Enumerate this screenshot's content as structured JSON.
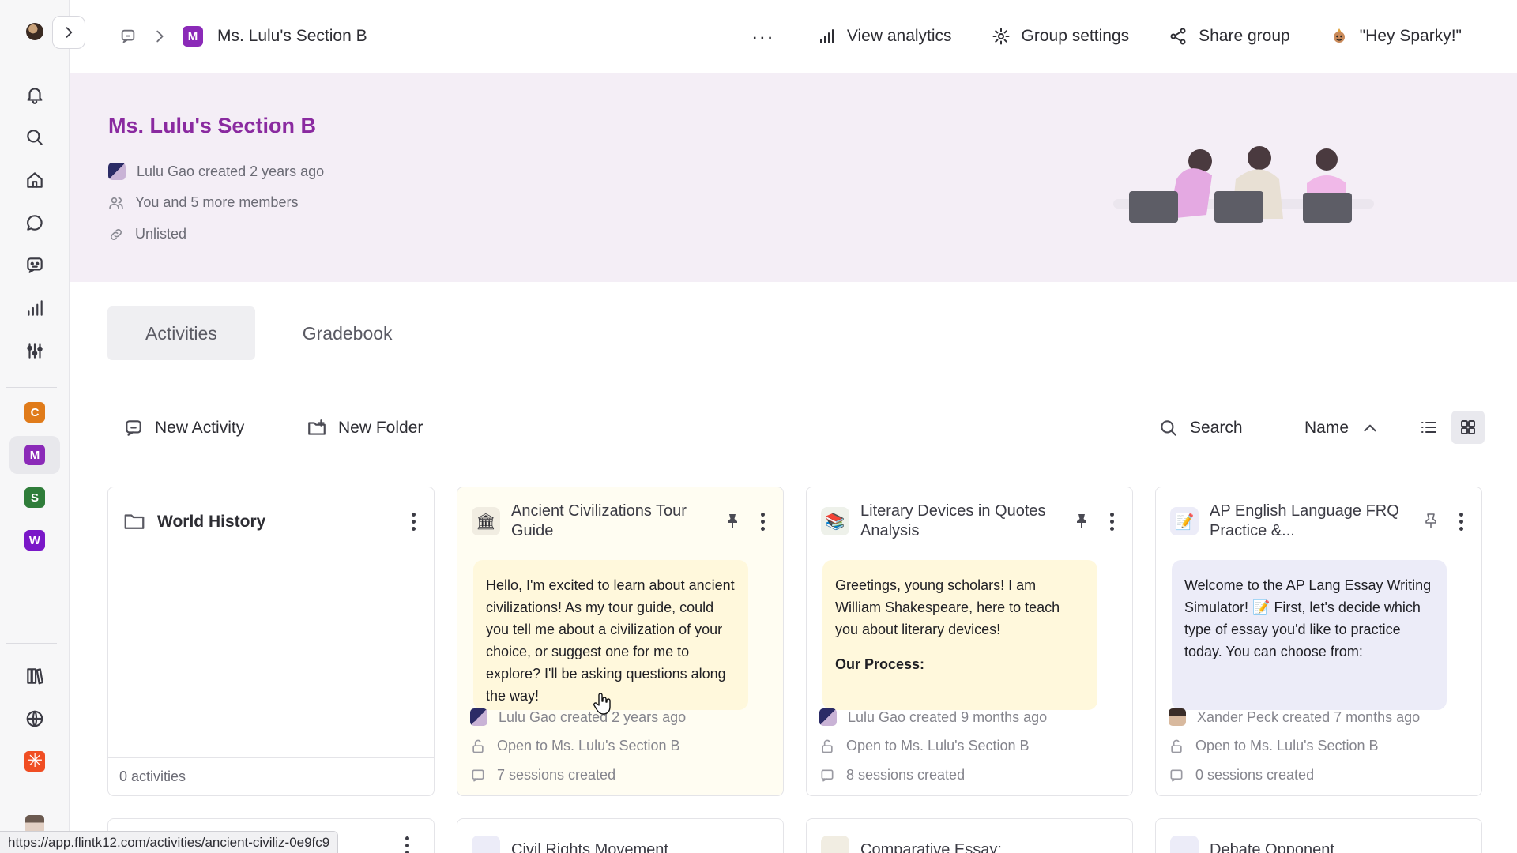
{
  "breadcrumb": {
    "group_letter": "M",
    "group_name": "Ms. Lulu's Section B"
  },
  "top_actions": {
    "more": "···",
    "view_analytics": "View analytics",
    "group_settings": "Group settings",
    "share_group": "Share group",
    "sparky": "\"Hey Sparky!\""
  },
  "rail": {
    "groups": [
      {
        "letter": "C",
        "color": "#e07b1a"
      },
      {
        "letter": "M",
        "color": "#8b2ab8"
      },
      {
        "letter": "S",
        "color": "#2f7d3a"
      },
      {
        "letter": "W",
        "color": "#7a18c8"
      }
    ]
  },
  "hero": {
    "title": "Ms. Lulu's Section B",
    "created": "Lulu Gao created 2 years ago",
    "members": "You and 5 more members",
    "visibility": "Unlisted"
  },
  "tabs": [
    {
      "label": "Activities",
      "active": true
    },
    {
      "label": "Gradebook",
      "active": false
    }
  ],
  "toolbar": {
    "new_activity": "New Activity",
    "new_folder": "New Folder",
    "search": "Search",
    "sort": "Name"
  },
  "folder": {
    "name": "World History",
    "count": "0 activities"
  },
  "cards": [
    {
      "title": "Ancient Civilizations Tour Guide",
      "icon": "🏛",
      "pinned": true,
      "message": "Hello, I'm excited to learn about ancient civilizations! As my tour guide, could you tell me about a civilization of your choice, or suggest one for me to explore? I'll be asking questions along the way!",
      "extra": "",
      "created": "Lulu Gao created 2 years ago",
      "access": "Open to Ms. Lulu's Section B",
      "sessions": "7 sessions created"
    },
    {
      "title": "Literary Devices in Quotes Analysis",
      "icon": "📚",
      "pinned": true,
      "message": "Greetings, young scholars! I am William Shakespeare, here to teach you about literary devices!",
      "extra": "Our Process:",
      "created": "Lulu Gao created 9 months ago",
      "access": "Open to Ms. Lulu's Section B",
      "sessions": "8 sessions created"
    },
    {
      "title": "AP English Language FRQ Practice &...",
      "icon": "📝",
      "pinned": false,
      "message": "Welcome to the AP Lang Essay Writing Simulator! 📝 First, let's decide which type of essay you'd like to practice today. You can choose from:",
      "extra": "",
      "created": "Xander Peck created 7 months ago",
      "access": "Open to Ms. Lulu's Section B",
      "sessions": "0 sessions created"
    }
  ],
  "bottom_cards": [
    "Civil Rights Movement",
    "Comparative Essay:",
    "Debate Opponent"
  ],
  "status_url": "https://app.flintk12.com/activities/ancient-civiliz-0e9fc9"
}
